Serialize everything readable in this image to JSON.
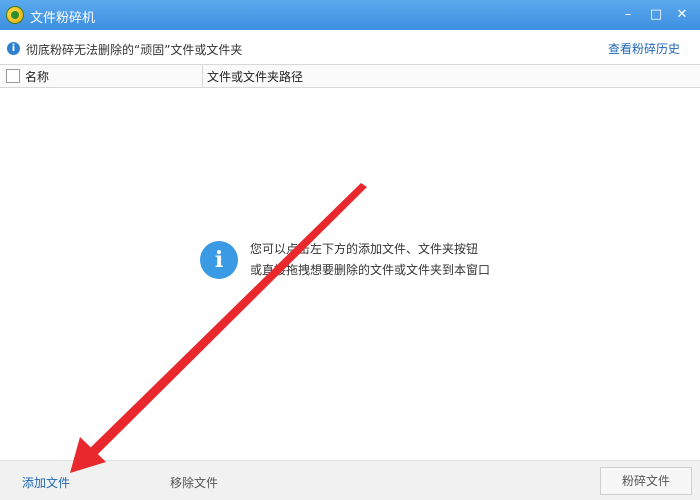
{
  "window": {
    "title": "文件粉碎机",
    "minimize": "–",
    "maximize": "□",
    "close": "✕"
  },
  "infobar": {
    "icon_char": "i",
    "text": "彻底粉碎无法删除的“顽固”文件或文件夹",
    "history_link": "查看粉碎历史"
  },
  "table": {
    "columns": [
      "名称",
      "文件或文件夹路径"
    ]
  },
  "empty_state": {
    "icon_char": "i",
    "line1": "您可以点击左下方的添加文件、文件夹按钮",
    "line2": "或直接拖拽想要删除的文件或文件夹到本窗口"
  },
  "footer": {
    "add_file": "添加文件",
    "remove_file": "移除文件",
    "shred_file": "粉碎文件"
  },
  "annotation": {
    "arrow_color": "#e8282c"
  },
  "colors": {
    "titlebar": "#4a9be8",
    "link": "#1f67b5",
    "info_icon": "#3a9ae4"
  }
}
